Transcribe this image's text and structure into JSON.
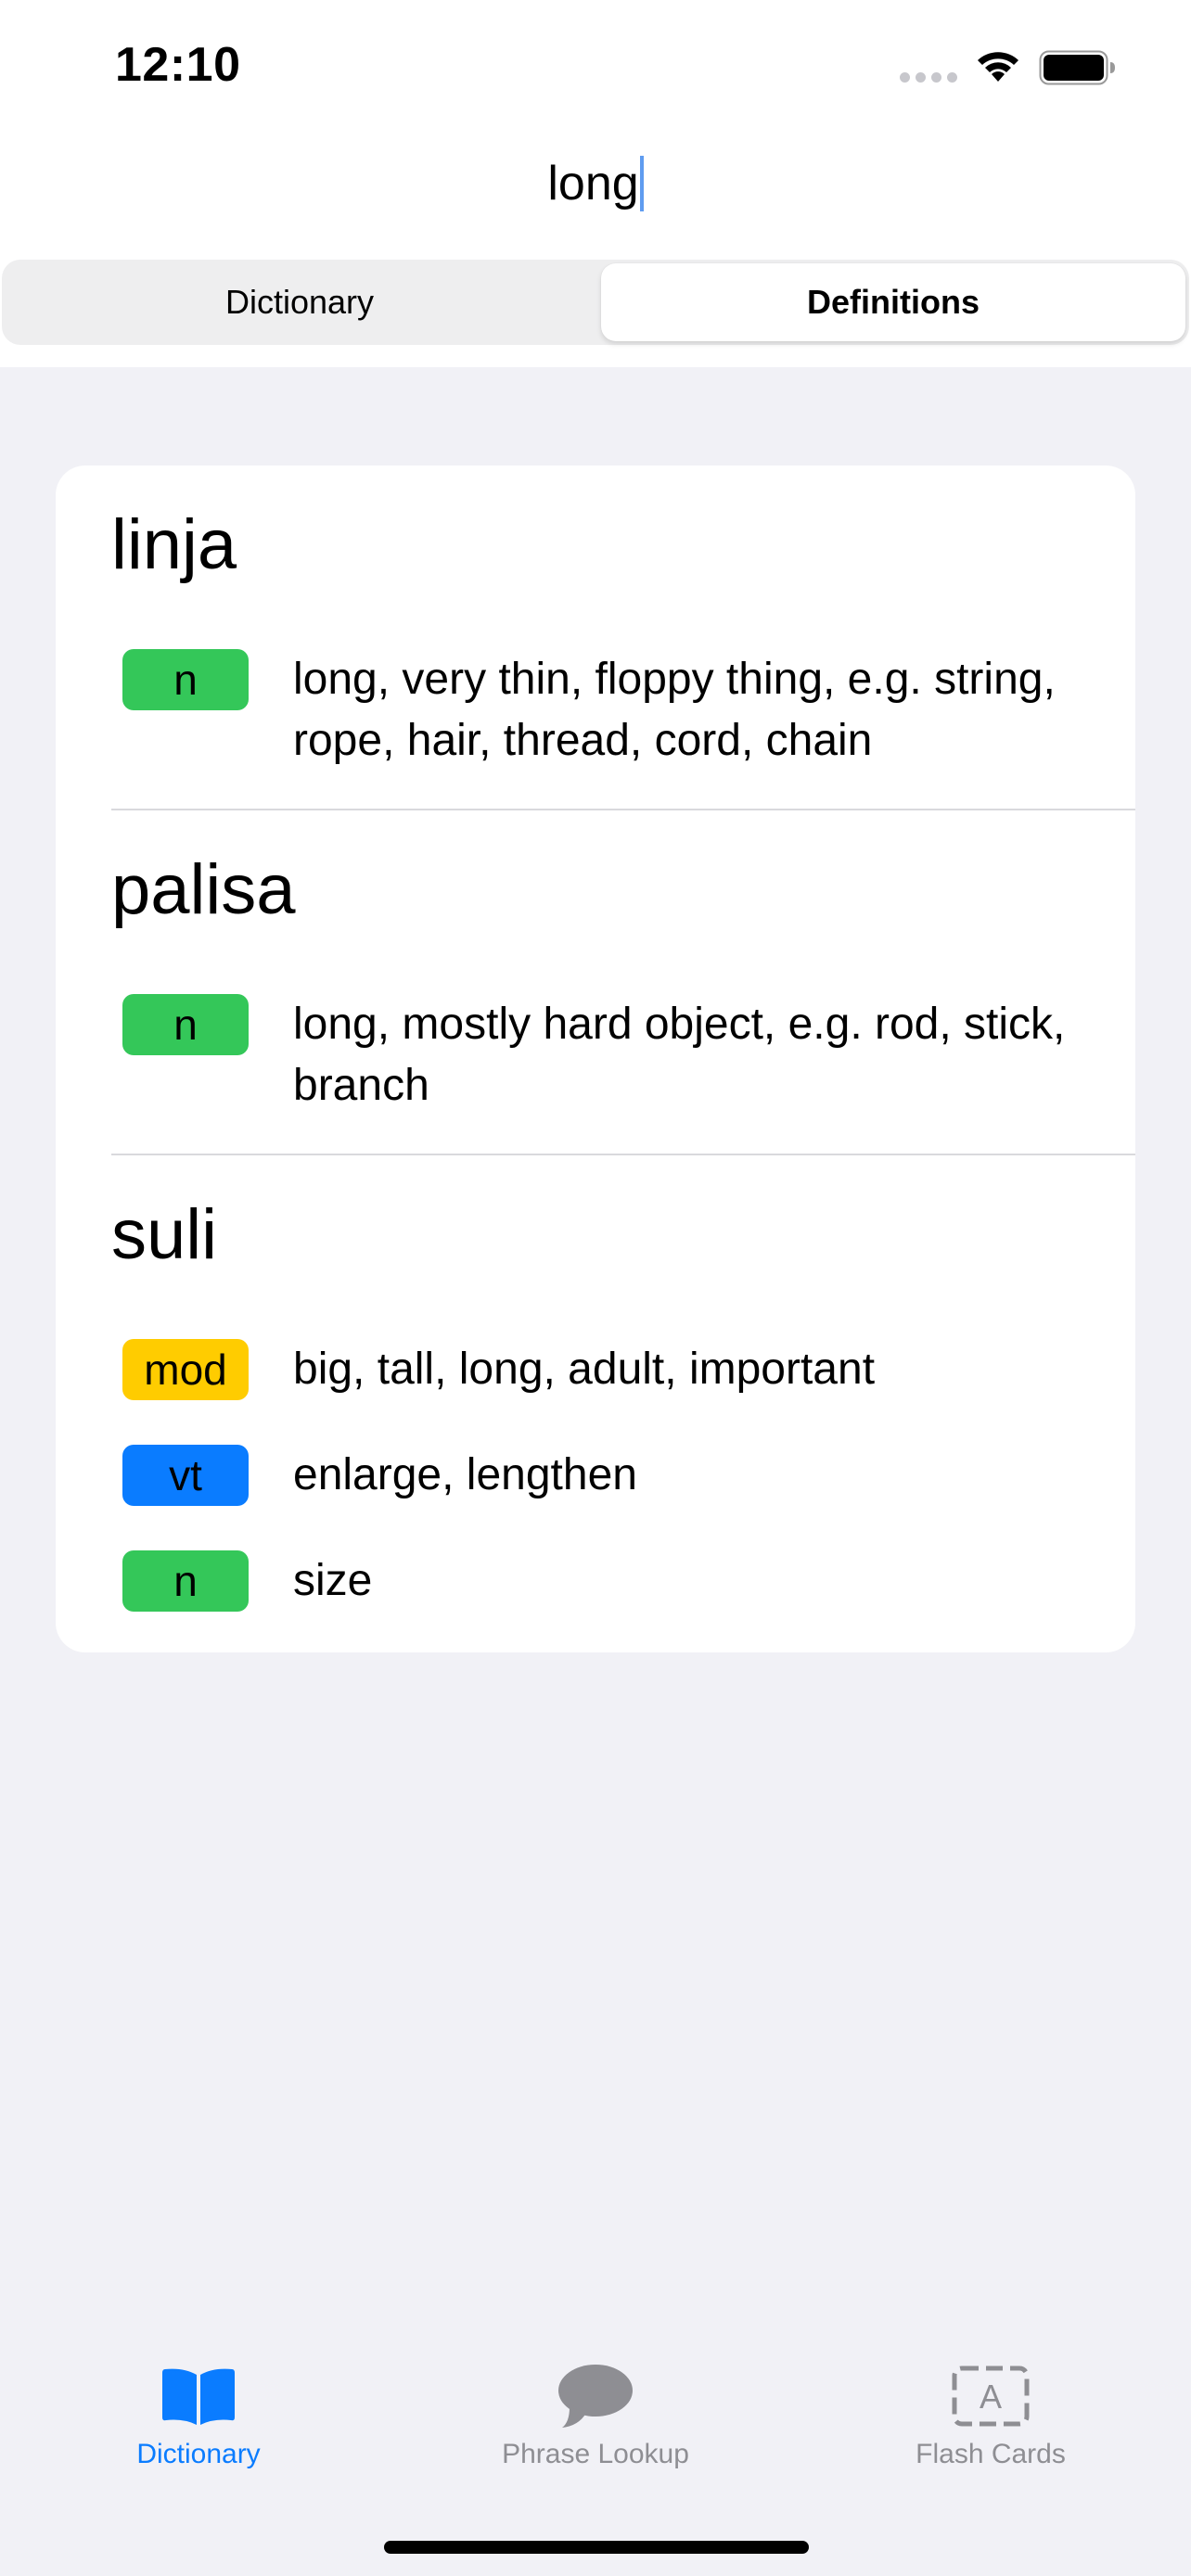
{
  "status_bar": {
    "time": "12:10"
  },
  "search": {
    "value": "long"
  },
  "segmented_control": {
    "options": [
      "Dictionary",
      "Definitions"
    ],
    "selected": "Definitions"
  },
  "results": [
    {
      "word": "linja",
      "definitions": [
        {
          "pos": "n",
          "text": "long, very thin, floppy thing, e.g. string, rope, hair, thread, cord, chain"
        }
      ]
    },
    {
      "word": "palisa",
      "definitions": [
        {
          "pos": "n",
          "text": "long, mostly hard object, e.g. rod, stick, branch"
        }
      ]
    },
    {
      "word": "suli",
      "definitions": [
        {
          "pos": "mod",
          "text": "big, tall, long, adult, important"
        },
        {
          "pos": "vt",
          "text": "enlarge, lengthen"
        },
        {
          "pos": "n",
          "text": "size"
        }
      ]
    }
  ],
  "pos_colors": {
    "n": "#34c759",
    "mod": "#ffcc00",
    "vt": "#0a7cff"
  },
  "tab_bar": {
    "items": [
      {
        "label": "Dictionary",
        "icon": "book-icon",
        "active": true
      },
      {
        "label": "Phrase Lookup",
        "icon": "speech-bubble-icon",
        "active": false
      },
      {
        "label": "Flash Cards",
        "icon": "flash-card-icon",
        "active": false
      }
    ]
  },
  "colors": {
    "accent": "#0a7cff",
    "background": "#f1f1f6",
    "inactive_tab": "#8e8e93"
  }
}
